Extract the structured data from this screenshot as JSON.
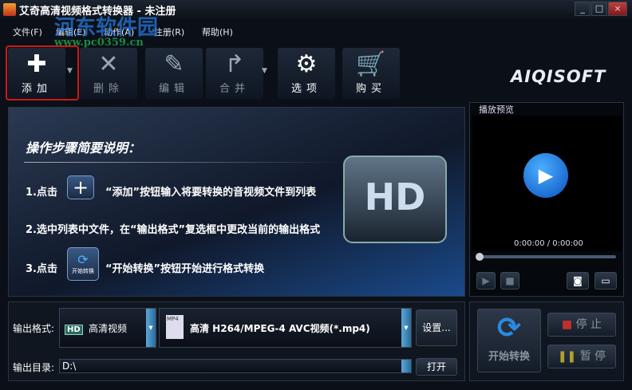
{
  "window": {
    "title": "艾奇高清视频格式转换器 - 未注册",
    "minimize": "_",
    "maximize": "□",
    "close": "×"
  },
  "watermark": {
    "name": "河东软件园",
    "url": "www.pc0359.cn"
  },
  "menu": [
    "文件(F)",
    "编辑(E)",
    "动作(A)",
    "注册(R)",
    "帮助(H)"
  ],
  "toolbar": {
    "add": "添加",
    "delete": "删除",
    "edit": "编辑",
    "merge": "合并",
    "options": "选项",
    "buy": "购买"
  },
  "logo": "AIQISOFT",
  "guide": {
    "heading": "操作步骤简要说明：",
    "step1_prefix": "1.点击",
    "step1_text": "“添加”按钮输入将要转换的音视频文件到列表",
    "step2": "2.选中列表中文件，在“输出格式”复选框中更改当前的输出格式",
    "step3_prefix": "3.点击",
    "step3_icon_label": "开始转换",
    "step3_text": "“开始转换”按钮开始进行格式转换",
    "hd_label": "HD"
  },
  "preview": {
    "label": "播放预览",
    "time": "0:00:00 / 0:00:00",
    "progress": 0
  },
  "output": {
    "format_label": "输出格式:",
    "category_badge": "HD",
    "category": "高清视频",
    "format_badge": "MP4",
    "format": "高清 H264/MPEG-4 AVC视频(*.mp4)",
    "settings": "设置...",
    "dir_label": "输出目录:",
    "dir": "D:\\",
    "open": "打开"
  },
  "controls": {
    "start": "开始转换",
    "stop": "停 止",
    "pause": "暂 停"
  }
}
